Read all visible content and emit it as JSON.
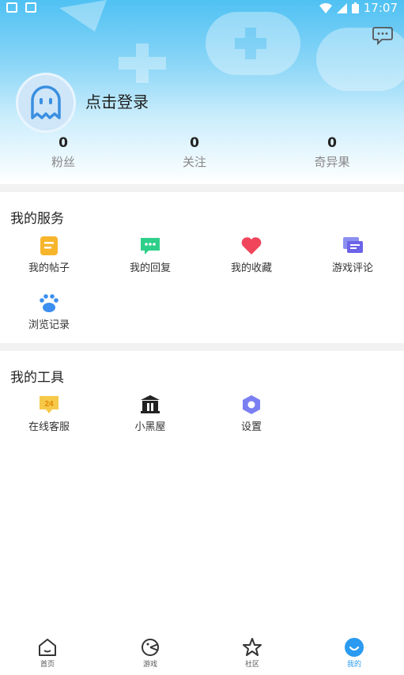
{
  "status_bar": {
    "time": "17:07"
  },
  "profile": {
    "login_prompt": "点击登录"
  },
  "stats": [
    {
      "value": "0",
      "label": "粉丝"
    },
    {
      "value": "0",
      "label": "关注"
    },
    {
      "value": "0",
      "label": "奇异果"
    }
  ],
  "services": {
    "title": "我的服务",
    "items": [
      {
        "label": "我的帖子",
        "icon": "post-icon"
      },
      {
        "label": "我的回复",
        "icon": "reply-icon"
      },
      {
        "label": "我的收藏",
        "icon": "heart-icon"
      },
      {
        "label": "游戏评论",
        "icon": "comment-icon"
      },
      {
        "label": "浏览记录",
        "icon": "paw-icon"
      }
    ]
  },
  "tools": {
    "title": "我的工具",
    "items": [
      {
        "label": "在线客服",
        "icon": "support-24-icon",
        "badge": "24"
      },
      {
        "label": "小黑屋",
        "icon": "jail-icon"
      },
      {
        "label": "设置",
        "icon": "settings-icon"
      }
    ]
  },
  "tabbar": {
    "items": [
      {
        "label": "首页",
        "icon": "home-icon"
      },
      {
        "label": "游戏",
        "icon": "game-icon"
      },
      {
        "label": "社区",
        "icon": "star-icon"
      },
      {
        "label": "我的",
        "icon": "profile-icon",
        "active": true
      }
    ]
  },
  "colors": {
    "accent": "#2a9bf0",
    "header_top": "#4fc1f3"
  }
}
